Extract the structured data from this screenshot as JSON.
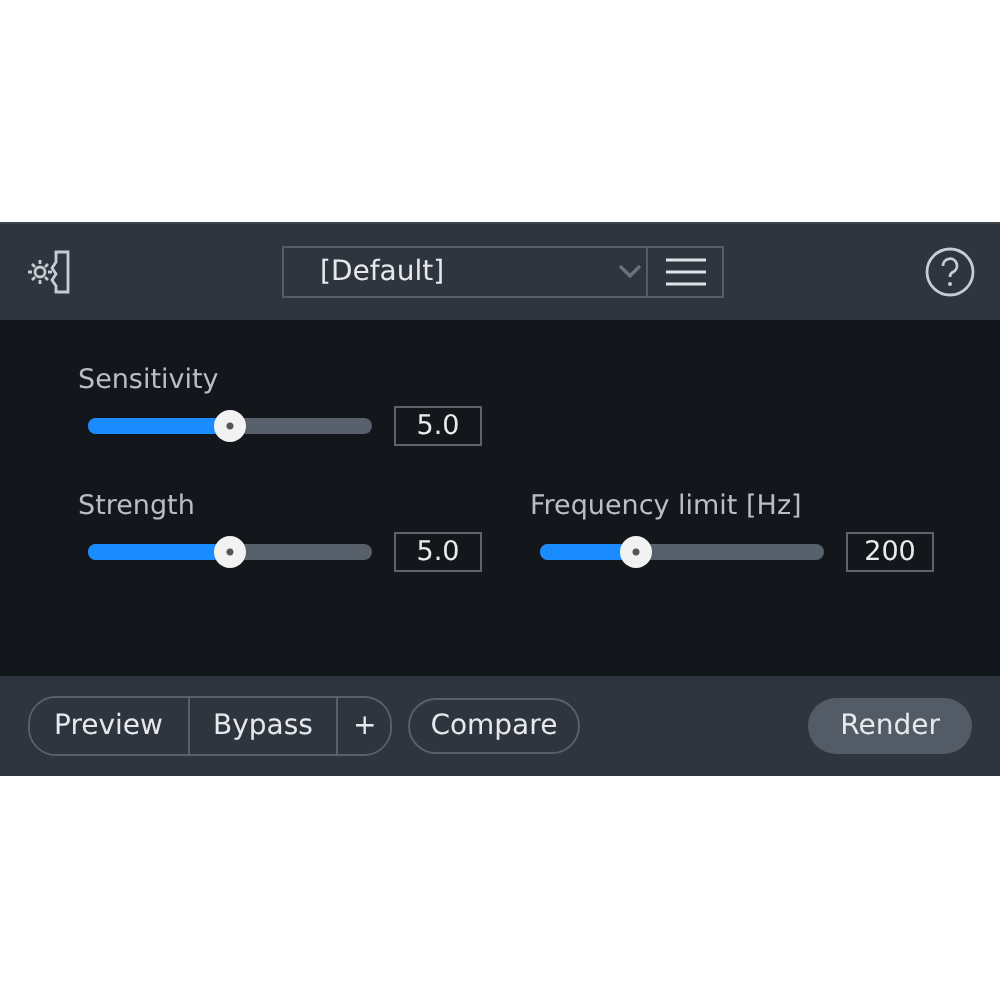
{
  "header": {
    "preset": "[Default]"
  },
  "controls": [
    {
      "label": "Sensitivity",
      "level": 0.5,
      "value": "5.0"
    },
    {
      "label": "Strength",
      "level": 0.5,
      "value": "5.0"
    },
    {
      "label": "Frequency limit [Hz]",
      "level": 0.34,
      "value": "200"
    }
  ],
  "footer": {
    "preview": "Preview",
    "bypass": "Bypass",
    "add": "+",
    "compare": "Compare",
    "render": "Render"
  }
}
